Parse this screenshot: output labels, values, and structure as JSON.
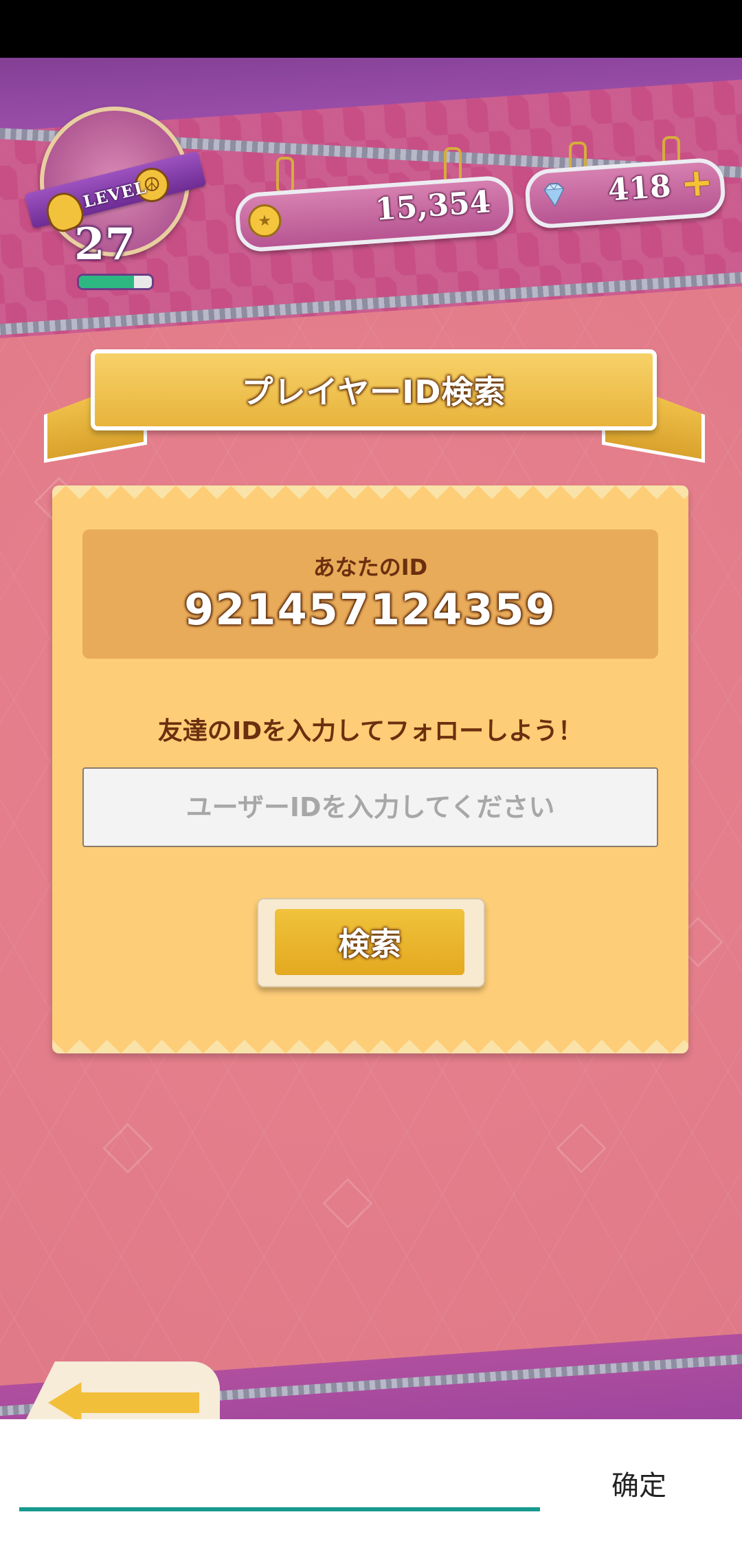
{
  "header": {
    "level_label": "LEVEL",
    "level": "27",
    "level_progress": 0.75,
    "coins": "15,354",
    "gems": "418",
    "plus_symbol": "+"
  },
  "banner": {
    "title": "プレイヤーID検索"
  },
  "panel": {
    "your_id_label": "あなたのID",
    "your_id_value": "921457124359",
    "instruction": "友達のIDを入力してフォローしよう！",
    "input_placeholder": "ユーザーIDを入力してください",
    "input_value": "",
    "search_button": "検索"
  },
  "ime": {
    "confirm_label": "确定"
  },
  "colors": {
    "background_pink": "#e8828f",
    "panel_yellow": "#fecd77",
    "id_box": "#e8ab59",
    "text_brown": "#6b2f0f",
    "button_gold": "#e3a920",
    "ime_underline": "#199a8e",
    "progress_green": "#2db882"
  },
  "icons": {
    "coin": "coin-icon",
    "gem": "gem-icon",
    "plus": "plus-icon",
    "hand": "hand-icon",
    "peace": "peace-icon",
    "back": "back-arrow-icon"
  }
}
